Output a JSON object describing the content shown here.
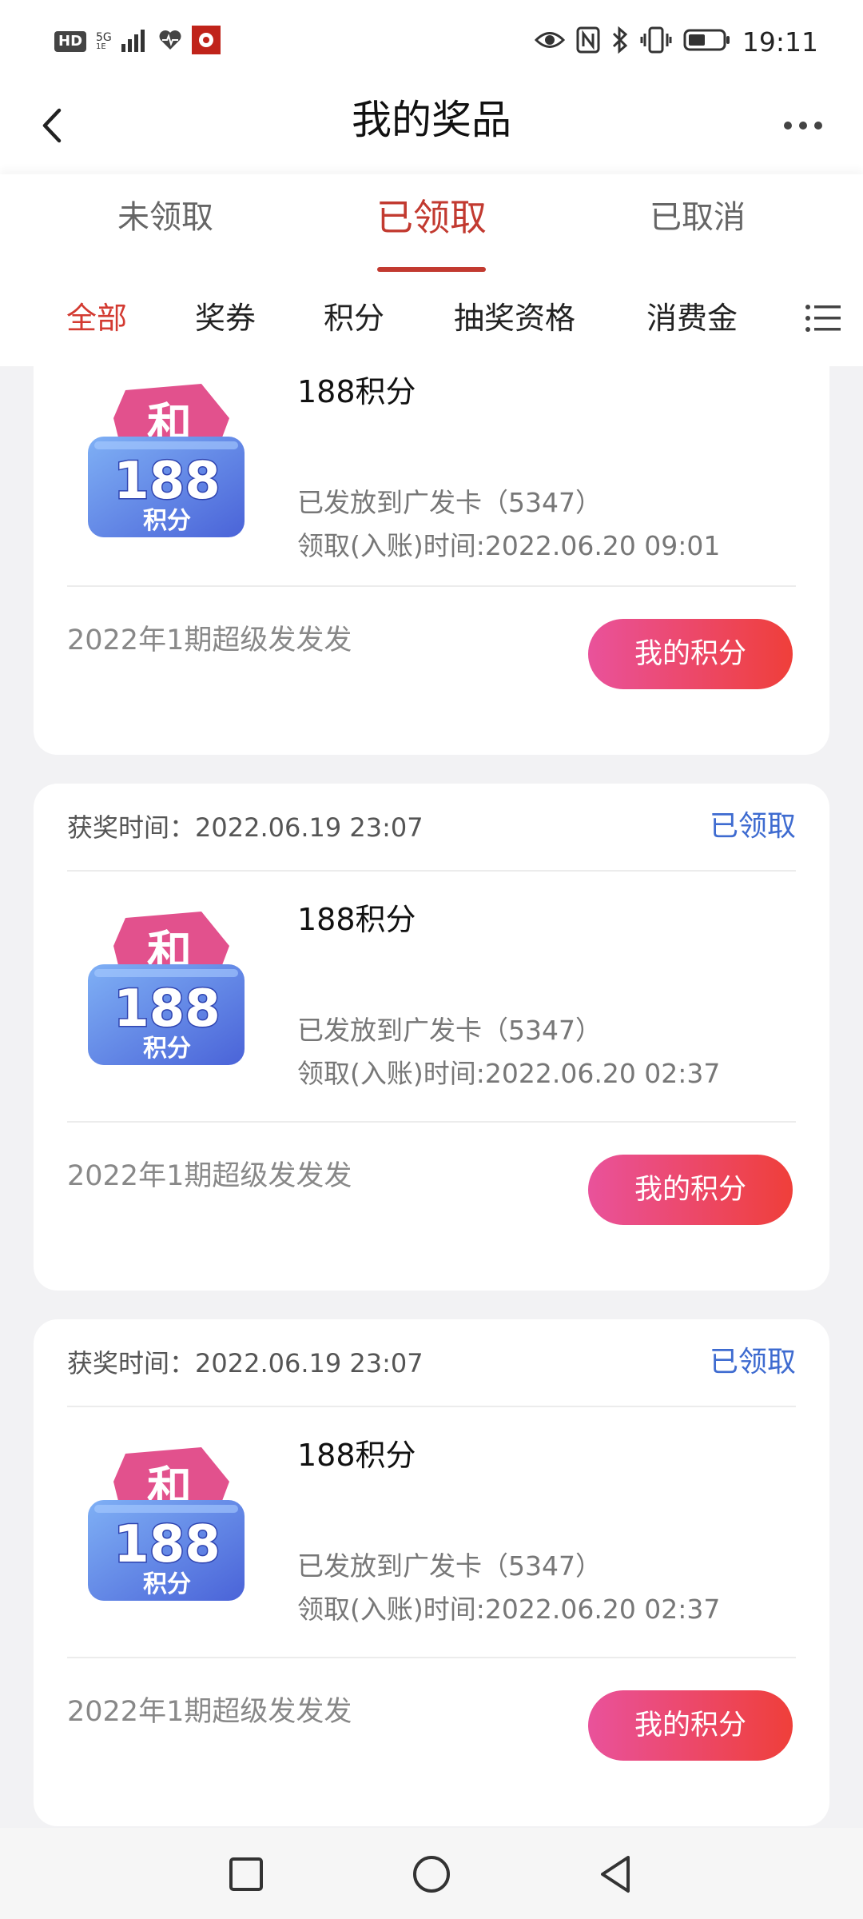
{
  "status_bar": {
    "hd_label": "HD",
    "network_top": "5G",
    "network_bottom": "1E",
    "time": "19:11",
    "icons": [
      "signal-icon",
      "heartbeat-icon",
      "app-notification-icon",
      "eye-icon",
      "nfc-icon",
      "bluetooth-icon",
      "vibrate-icon",
      "battery-icon"
    ]
  },
  "nav": {
    "title": "我的奖品",
    "back_icon": "chevron-left-icon",
    "more_icon": "more-dots-icon"
  },
  "status_tabs": [
    {
      "label": "未领取",
      "active": false
    },
    {
      "label": "已领取",
      "active": true
    },
    {
      "label": "已取消",
      "active": false
    }
  ],
  "category_tabs": [
    {
      "label": "全部",
      "active": true
    },
    {
      "label": "奖券",
      "active": false
    },
    {
      "label": "积分",
      "active": false
    },
    {
      "label": "抽奖资格",
      "active": false
    },
    {
      "label": "消费金",
      "active": false
    }
  ],
  "category_menu_icon": "list-menu-icon",
  "prize_badge": {
    "top_char": "和",
    "number": "188",
    "unit": "积分"
  },
  "cards": [
    {
      "prize_name": "188积分",
      "delivery": "已发放到广发卡（5347）",
      "claim_time": "领取(入账)时间:2022.06.20 09:01",
      "campaign": "2022年1期超级发发发",
      "button": "我的积分"
    },
    {
      "win_time": "获奖时间：2022.06.19 23:07",
      "status": "已领取",
      "prize_name": "188积分",
      "delivery": "已发放到广发卡（5347）",
      "claim_time": "领取(入账)时间:2022.06.20 02:37",
      "campaign": "2022年1期超级发发发",
      "button": "我的积分"
    },
    {
      "win_time": "获奖时间：2022.06.19 23:07",
      "status": "已领取",
      "prize_name": "188积分",
      "delivery": "已发放到广发卡（5347）",
      "claim_time": "领取(入账)时间:2022.06.20 02:37",
      "campaign": "2022年1期超级发发发",
      "button": "我的积分"
    }
  ],
  "colors": {
    "accent_red": "#c23a30",
    "claimed_blue": "#3e6bd0",
    "button_gradient_start": "#e9529b",
    "button_gradient_end": "#ef3f3a"
  },
  "system_nav": [
    "square-icon",
    "circle-icon",
    "triangle-back-icon"
  ]
}
